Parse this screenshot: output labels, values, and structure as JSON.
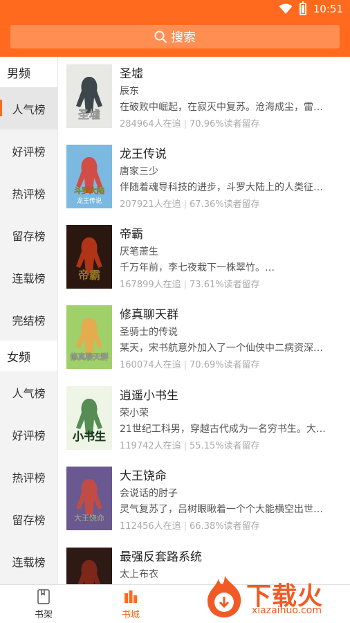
{
  "status": {
    "time": "10:51"
  },
  "search": {
    "label": "搜索"
  },
  "sidebar": {
    "male_section": "男频",
    "male_items": [
      "人气榜",
      "好评榜",
      "热评榜",
      "留存榜",
      "连载榜",
      "完结榜"
    ],
    "female_section": "女频",
    "female_items": [
      "人气榜",
      "好评榜",
      "热评榜",
      "留存榜",
      "连载榜"
    ],
    "active_item": "人气榜"
  },
  "books": [
    {
      "title": "圣墟",
      "author": "辰东",
      "desc": "在破败中崛起，在寂灭中复苏。沧海成尘，雷…",
      "followers": "284964人在追",
      "retention": "70.96%读者留存"
    },
    {
      "title": "龙王传说",
      "author": "唐家三少",
      "desc": "伴随着魂导科技的进步，斗罗大陆上的人类征…",
      "followers": "207921人在追",
      "retention": "67.36%读者留存"
    },
    {
      "title": "帝霸",
      "author": "厌笔萧生",
      "desc": "千万年前，李七夜栽下一株翠竹。…",
      "followers": "167899人在追",
      "retention": "73.61%读者留存"
    },
    {
      "title": "修真聊天群",
      "author": "圣骑士的传说",
      "desc": "某天，宋书航意外加入了一个仙侠中二病资深…",
      "followers": "160074人在追",
      "retention": "70.69%读者留存"
    },
    {
      "title": "逍遥小书生",
      "author": "荣小荣",
      "desc": "21世纪工科男，穿越古代成为一名穷书生。大…",
      "followers": "119742人在追",
      "retention": "55.15%读者留存"
    },
    {
      "title": "大王饶命",
      "author": "会说话的肘子",
      "desc": "灵气复苏了，吕树眼瞅着一个个大能横空出世…",
      "followers": "112456人在追",
      "retention": "66.38%读者留存"
    },
    {
      "title": "最强反套路系统",
      "author": "太上布衣",
      "desc": "",
      "followers": "",
      "retention": ""
    }
  ],
  "covers": [
    {
      "title": "圣墟",
      "bg": "#e8e8e4",
      "accent": "#1f2a30",
      "text": "#ffffff"
    },
    {
      "title": "斗罗大陆",
      "sub": "龙王传说",
      "bg": "#7bb9e0",
      "accent": "#e23a2a",
      "text": "#ffd700"
    },
    {
      "title": "帝霸",
      "bg": "#2a1810",
      "accent": "#c83a18",
      "text": "#f5c242"
    },
    {
      "title": "修真聊天群",
      "bg": "#9fd06a",
      "accent": "#f0a64a",
      "text": "#ffffff"
    },
    {
      "title": "小书生",
      "bg": "#eef4e6",
      "accent": "#3a7a3a",
      "text": "#2a5a2a"
    },
    {
      "title": "大王饶命",
      "bg": "#6a5890",
      "accent": "#d04a3a",
      "text": "#ffffff"
    },
    {
      "title": "",
      "bg": "#2e1a14",
      "accent": "#8a2a1a",
      "text": "#ffffff"
    }
  ],
  "nav": {
    "shelf": "书架",
    "store": "书城"
  },
  "watermark": {
    "text": "下载火",
    "domain": "xiazaihuo.com"
  },
  "colors": {
    "brand": "#ff6a1f",
    "search_bg": "#ff8e52",
    "stats_text": "#aaaaaa"
  }
}
